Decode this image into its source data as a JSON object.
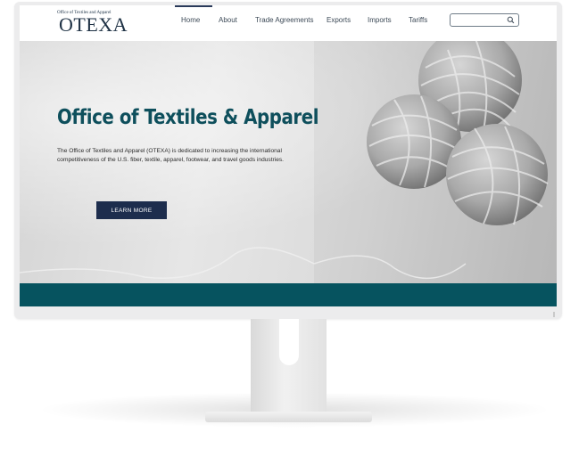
{
  "header": {
    "logo_small": "Office of Textiles and Apparel",
    "logo_big": "OTEXA",
    "nav": [
      {
        "label": "Home",
        "active": true
      },
      {
        "label": "About"
      },
      {
        "label": "Trade Agreements"
      },
      {
        "label": "Exports"
      },
      {
        "label": "Imports"
      },
      {
        "label": "Tariffs"
      }
    ],
    "search": {
      "placeholder": "",
      "icon": "search-icon"
    }
  },
  "hero": {
    "title": "Office of Textiles & Apparel",
    "description": "The Office of Textiles and Apparel (OTEXA) is dedicated to increasing the international competitiveness of the U.S. fiber, textile, apparel, footwear, and travel goods industries.",
    "cta_label": "LEARN MORE",
    "image": "yarn-balls-image"
  },
  "colors": {
    "brand_navy": "#1d2d4d",
    "brand_teal": "#06535f",
    "title_teal": "#0e4f5c"
  }
}
